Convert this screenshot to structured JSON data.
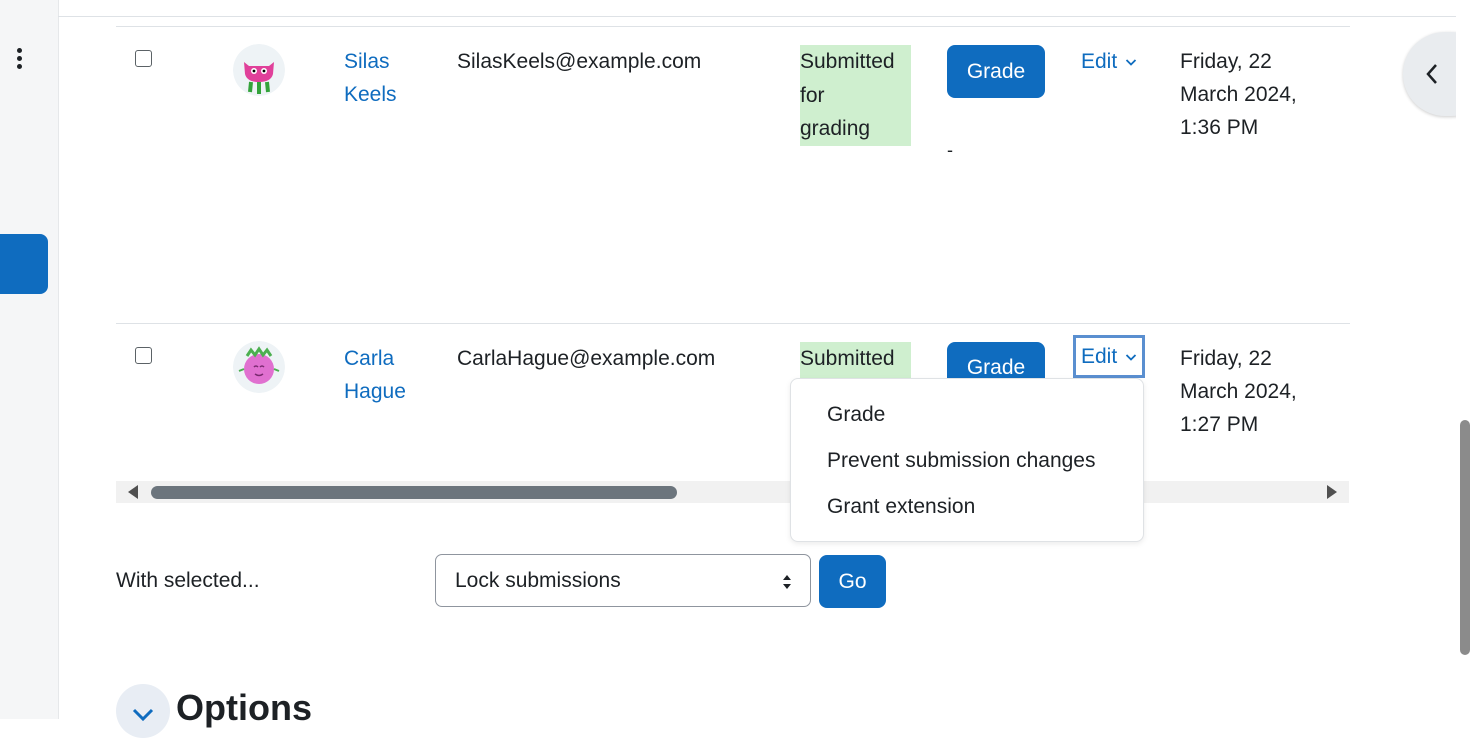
{
  "table": {
    "rows": [
      {
        "name_first": "Silas",
        "name_last": "Keels",
        "email": "SilasKeels@example.com",
        "status_lines": [
          "Submitted",
          "for",
          "grading"
        ],
        "grade_button": "Grade",
        "grade_value": "-",
        "edit_label": "Edit",
        "date_lines": [
          "Friday, 22",
          "March 2024,",
          "1:36 PM"
        ]
      },
      {
        "name_first": "Carla",
        "name_last": "Hague",
        "email": "CarlaHague@example.com",
        "status_lines": [
          "Submitted"
        ],
        "grade_button": "Grade",
        "edit_label": "Edit",
        "date_lines": [
          "Friday, 22",
          "March 2024,",
          "1:27 PM"
        ]
      }
    ]
  },
  "dropdown": {
    "items": [
      "Grade",
      "Prevent submission changes",
      "Grant extension"
    ]
  },
  "bulk": {
    "label": "With selected...",
    "selected_option": "Lock submissions",
    "go_button": "Go"
  },
  "options_section": {
    "title": "Options"
  },
  "colors": {
    "primary": "#0f6cbf",
    "status_bg": "#cfefcf",
    "avatar1": "#e0409a",
    "avatar2": "#e070d0"
  },
  "icons": {
    "kebab": "kebab-menu-icon",
    "chevron_left": "chevron-left-icon",
    "chevron_down": "chevron-down-icon"
  }
}
